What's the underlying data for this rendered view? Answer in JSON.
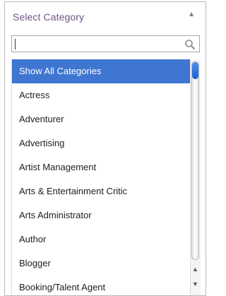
{
  "select": {
    "label": "Select Category",
    "arrow_icon": "caret-up-icon",
    "accent_color": "#6f5488"
  },
  "search": {
    "value": "",
    "placeholder": "",
    "icon": "search-icon"
  },
  "categories": [
    {
      "label": "Show All Categories",
      "selected": true
    },
    {
      "label": "Actress",
      "selected": false
    },
    {
      "label": "Adventurer",
      "selected": false
    },
    {
      "label": "Advertising",
      "selected": false
    },
    {
      "label": "Artist Management",
      "selected": false
    },
    {
      "label": "Arts & Entertainment Critic",
      "selected": false
    },
    {
      "label": "Arts Administrator",
      "selected": false
    },
    {
      "label": "Author",
      "selected": false
    },
    {
      "label": "Blogger",
      "selected": false
    },
    {
      "label": "Booking/Talent Agent",
      "selected": false
    }
  ],
  "colors": {
    "selected_bg": "#3f76d1",
    "selected_text": "#ffffff"
  }
}
